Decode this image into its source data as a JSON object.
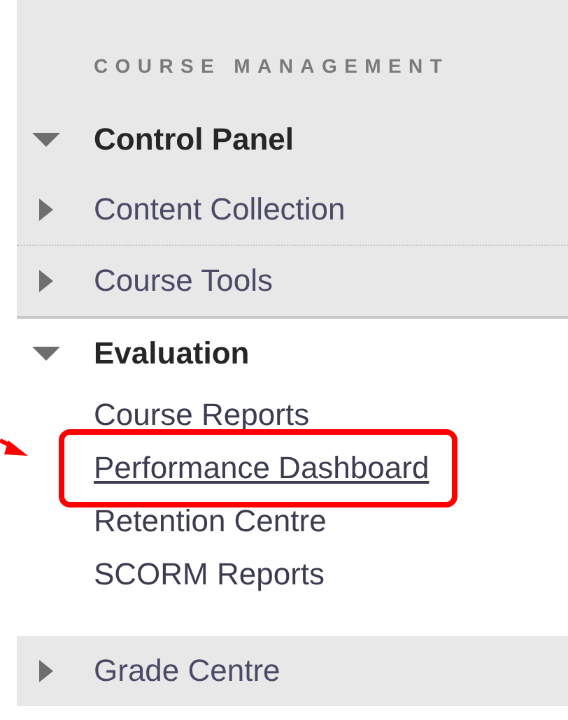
{
  "sidebar": {
    "title": "COURSE MANAGEMENT",
    "items": [
      {
        "label": "Control Panel",
        "expanded": true,
        "children": [
          {
            "label": "Content Collection",
            "expanded": false
          },
          {
            "label": "Course Tools",
            "expanded": false
          },
          {
            "label": "Evaluation",
            "expanded": true,
            "links": [
              {
                "label": "Course Reports",
                "underlined": false,
                "highlighted": false
              },
              {
                "label": "Performance Dashboard",
                "underlined": true,
                "highlighted": true
              },
              {
                "label": "Retention Centre",
                "underlined": false,
                "highlighted": false
              },
              {
                "label": "SCORM Reports",
                "underlined": false,
                "highlighted": false
              }
            ]
          },
          {
            "label": "Grade Centre",
            "expanded": false
          }
        ]
      }
    ]
  }
}
